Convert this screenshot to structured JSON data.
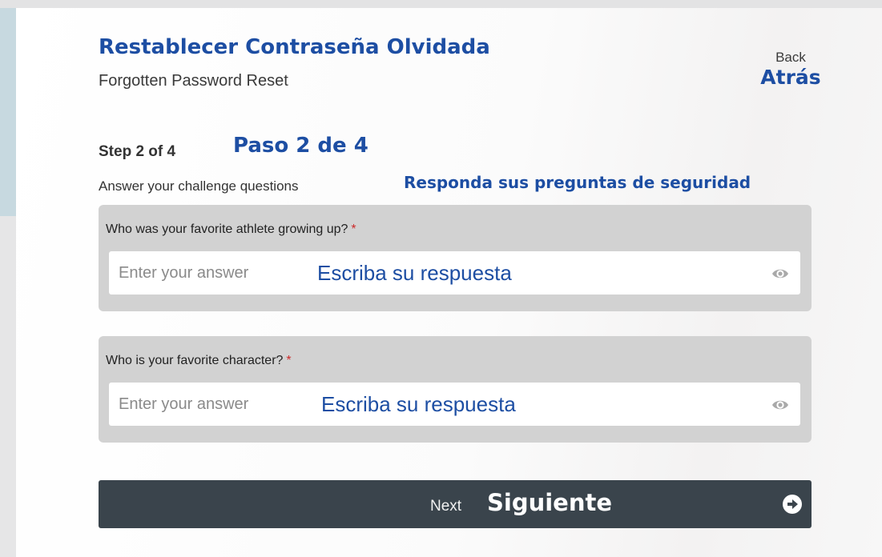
{
  "header": {
    "title_es": "Restablecer Contraseña Olvidada",
    "title_en": "Forgotten Password Reset",
    "back_en": "Back",
    "back_es": "Atrás"
  },
  "step": {
    "label_en": "Step 2 of 4",
    "label_es": "Paso 2 de 4",
    "instructions_en": "Answer your challenge questions",
    "instructions_es": "Responda sus preguntas de seguridad"
  },
  "questions": [
    {
      "label": "Who was your favorite athlete growing up?",
      "required_mark": "*",
      "placeholder_en": "Enter your answer",
      "placeholder_es": "Escriba su respuesta",
      "value": "",
      "toggle_icon": "eye-icon"
    },
    {
      "label": "Who is your favorite character?",
      "required_mark": "*",
      "placeholder_en": "Enter your answer",
      "placeholder_es": "Escriba su respuesta",
      "value": "",
      "toggle_icon": "eye-icon"
    }
  ],
  "next_button": {
    "label_en": "Next",
    "label_es": "Siguiente",
    "icon": "arrow-right-circle-icon"
  },
  "colors": {
    "accent_blue": "#1d4ea3",
    "button_bg": "#3a444c",
    "question_bg": "#d2d2d2",
    "required": "#cc2b2b"
  }
}
